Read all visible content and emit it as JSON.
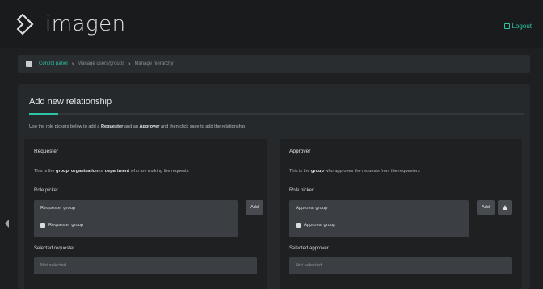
{
  "header": {
    "app_name": "imagen",
    "logout_label": "Logout"
  },
  "breadcrumb": {
    "items": [
      "Control panel",
      "Manage users/groups",
      "Manage hierarchy"
    ]
  },
  "panel": {
    "title": "Add new relationship",
    "intro_prefix": "Use the role pickers below to add a ",
    "intro_requester": "Requester",
    "intro_middle": " and an ",
    "intro_approver": "Approver",
    "intro_suffix": " and then click save to add the relationship"
  },
  "requester": {
    "title": "Requester",
    "desc_prefix": "This is the ",
    "desc_group": "group",
    "desc_sep1": ", ",
    "desc_org": "organisation",
    "desc_sep2": " or ",
    "desc_dept": "department",
    "desc_suffix": " who are making the requests",
    "role_picker_label": "Role picker",
    "picker_value": "Requester group",
    "option_label": "Requester group",
    "add_label": "Add",
    "selected_label": "Selected requester",
    "selected_value": "Not selected"
  },
  "approver": {
    "title": "Approver",
    "desc_prefix": "This is the ",
    "desc_group": "group",
    "desc_suffix": " who approves the requests from the requesters",
    "role_picker_label": "Role picker",
    "picker_value": "Approval group",
    "option_label": "Approval group",
    "add_label": "Add",
    "selected_label": "Selected approver",
    "selected_value": "Not selected"
  },
  "colors": {
    "accent": "#2ec4a6",
    "background": "#1d1f21",
    "panel": "#26292c"
  },
  "icons": [
    "imagen-logo-icon",
    "logout-icon",
    "home-icon",
    "group-icon",
    "person-icon",
    "chevron-left-icon"
  ]
}
